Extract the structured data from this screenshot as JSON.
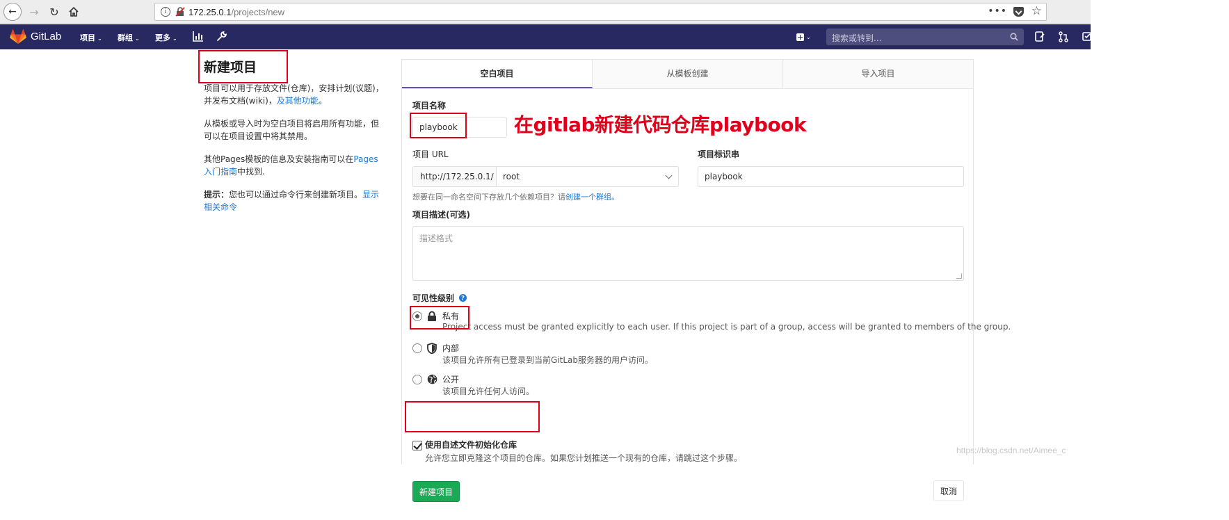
{
  "browser": {
    "url_host": "172.25.0.1",
    "url_path": "/projects/new",
    "info_glyph": "i",
    "more_glyph": "•••"
  },
  "header": {
    "brand": "GitLab",
    "nav": {
      "projects": "项目",
      "groups": "群组",
      "more": "更多"
    },
    "search_placeholder": "搜索或转到...",
    "colors": {
      "header_bg": "#292961",
      "accent": "#6b4fbb"
    }
  },
  "left": {
    "title": "新建项目",
    "p1": "项目可以用于存放文件(仓库)，安排计划(议题)，并发布文档(wiki)，",
    "p1_link": "及其他功能",
    "p1_end": "。",
    "p2": "从模板或导入时为空白项目将启用所有功能，但可以在项目设置中将其禁用。",
    "p3": "其他Pages模板的信息及安装指南可以在",
    "p3_link": "Pages入门指南",
    "p3_end": "中找到.",
    "p4_label": "提示：",
    "p4": "您也可以通过命令行来创建新项目。",
    "p4_link": "显示相关命令"
  },
  "tabs": {
    "blank": "空白项目",
    "template": "从模板创建",
    "import": "导入项目"
  },
  "form": {
    "name_label": "项目名称",
    "name_value": "playbook",
    "url_label": "项目 URL",
    "url_prefix": "http://172.25.0.1/",
    "namespace_value": "root",
    "slug_label": "项目标识串",
    "slug_value": "playbook",
    "group_help": "想要在同一命名空间下存放几个依赖项目？请",
    "group_help_link": "创建一个群组。",
    "desc_label": "项目描述(可选)",
    "desc_placeholder": "描述格式",
    "visibility_label": "可见性级别",
    "visibility": [
      {
        "title": "私有",
        "desc": "Project access must be granted explicitly to each user. If this project is part of a group, access will be granted to members of the group.",
        "checked": true
      },
      {
        "title": "内部",
        "desc": "该项目允许所有已登录到当前GitLab服务器的用户访问。",
        "checked": false
      },
      {
        "title": "公开",
        "desc": "该项目允许任何人访问。",
        "checked": false
      }
    ],
    "readme_label": "使用自述文件初始化仓库",
    "readme_desc": "允许您立即克隆这个项目的仓库。如果您计划推送一个现有的仓库，请跳过这个步骤。",
    "create_button": "新建项目",
    "cancel_button": "取消"
  },
  "annotation": "在gitlab新建代码仓库playbook",
  "watermark": "https://blog.csdn.net/Aimee_c"
}
